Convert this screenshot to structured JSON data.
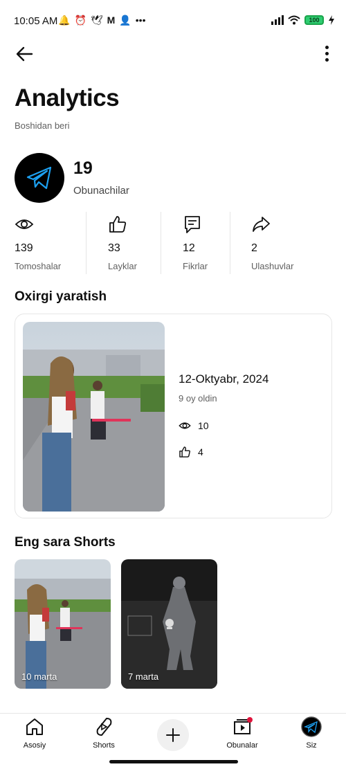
{
  "status_bar": {
    "time": "10:05 AM",
    "left_icons": [
      "alarm-bell-icon",
      "alarm-clock-icon",
      "bird-icon",
      "gmail-icon",
      "person-icon",
      "more-dots-icon"
    ],
    "battery": "100"
  },
  "header": {
    "title": "Analytics",
    "subtitle": "Boshidan beri"
  },
  "channel": {
    "subscribers": "19",
    "subscribers_label": "Obunachilar",
    "avatar_color": "#000000",
    "accent": "#1da1f2"
  },
  "stats": [
    {
      "icon": "eye-icon",
      "value": "139",
      "label": "Tomoshalar"
    },
    {
      "icon": "thumbs-up-icon",
      "value": "33",
      "label": "Layklar"
    },
    {
      "icon": "comment-icon",
      "value": "12",
      "label": "Fikrlar"
    },
    {
      "icon": "share-icon",
      "value": "2",
      "label": "Ulashuvlar"
    }
  ],
  "latest": {
    "section_title": "Oxirgi yaratish",
    "date": "12-Oktyabr, 2024",
    "ago": "9 oy oldin",
    "views": "10",
    "likes": "4"
  },
  "shorts": {
    "section_title": "Eng sara Shorts",
    "items": [
      {
        "label": "10 marta"
      },
      {
        "label": "7 marta"
      }
    ]
  },
  "nav": {
    "items": [
      {
        "label": "Asosiy"
      },
      {
        "label": "Shorts"
      },
      {
        "label": ""
      },
      {
        "label": "Obunalar"
      },
      {
        "label": "Siz"
      }
    ]
  }
}
